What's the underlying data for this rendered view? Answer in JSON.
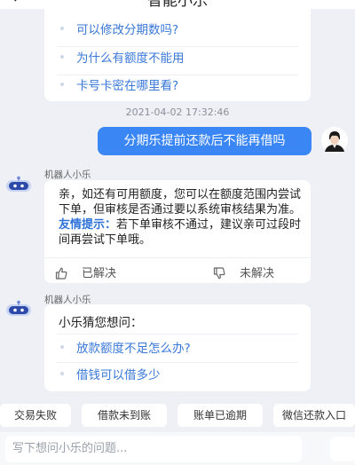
{
  "header": {
    "title": "智能小乐"
  },
  "faq_top": {
    "items": [
      {
        "label": "可以修改分期数吗?"
      },
      {
        "label": "为什么有额度不能用"
      },
      {
        "label": "卡号卡密在哪里看?"
      }
    ]
  },
  "timestamp": "2021-04-02 17:32:46",
  "user_message": "分期乐提前还款后不能再借吗",
  "bot_name": "机器人小乐",
  "answer": {
    "text": "亲，如还有可用额度，您可以在额度范围内尝试下单，但审核是否通过要以系统审核结果为准。",
    "tip_label": "友情提示：",
    "tip_text": "若下单审核不通过，建议亲可过段时间再尝试下单哦。",
    "resolved_label": "已解决",
    "unresolved_label": "未解决"
  },
  "guess": {
    "title": "小乐猜您想问：",
    "items": [
      {
        "label": "放款额度不足怎么办?"
      },
      {
        "label": "借钱可以借多少"
      }
    ]
  },
  "quick_actions": [
    "交易失败",
    "借款未到账",
    "账单已逾期",
    "微信还款入口"
  ],
  "input": {
    "placeholder": "写下想问小乐的问题..."
  },
  "colors": {
    "accent": "#3a86f5",
    "link": "#3a78d8",
    "background": "#eef0f5"
  }
}
